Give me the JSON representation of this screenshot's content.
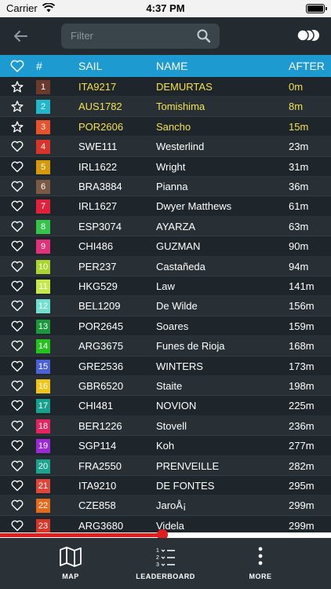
{
  "status_bar": {
    "carrier": "Carrier",
    "time": "4:37 PM"
  },
  "search": {
    "placeholder": "Filter"
  },
  "table": {
    "headers": {
      "pos": "#",
      "sail": "SAIL",
      "name": "NAME",
      "after": "AFTER"
    },
    "rows": [
      {
        "pos": "1",
        "color": "#6a3b2c",
        "sail": "ITA9217",
        "name": "DEMURTAS",
        "after": "0m",
        "favorite": "star"
      },
      {
        "pos": "2",
        "color": "#22b7c8",
        "sail": "AUS1782",
        "name": "Tomishima",
        "after": "8m",
        "favorite": "star"
      },
      {
        "pos": "3",
        "color": "#e8512a",
        "sail": "POR2606",
        "name": "Sancho",
        "after": "15m",
        "favorite": "star"
      },
      {
        "pos": "4",
        "color": "#d8352a",
        "sail": "SWE111",
        "name": "Westerlind",
        "after": "23m",
        "favorite": "heart"
      },
      {
        "pos": "5",
        "color": "#d49a0c",
        "sail": "IRL1622",
        "name": "Wright",
        "after": "31m",
        "favorite": "heart"
      },
      {
        "pos": "6",
        "color": "#7b5a45",
        "sail": "BRA3884",
        "name": "Pianna",
        "after": "36m",
        "favorite": "heart"
      },
      {
        "pos": "7",
        "color": "#e0213d",
        "sail": "IRL1627",
        "name": "Dwyer Matthews",
        "after": "61m",
        "favorite": "heart"
      },
      {
        "pos": "8",
        "color": "#35c34b",
        "sail": "ESP3074",
        "name": "AYARZA",
        "after": "63m",
        "favorite": "heart"
      },
      {
        "pos": "9",
        "color": "#e2317a",
        "sail": "CHI486",
        "name": "GUZMAN",
        "after": "90m",
        "favorite": "heart"
      },
      {
        "pos": "10",
        "color": "#a8d62c",
        "sail": "PER237",
        "name": "Castañeda",
        "after": "94m",
        "favorite": "heart"
      },
      {
        "pos": "11",
        "color": "#c6e84a",
        "sail": "HKG529",
        "name": "Law",
        "after": "141m",
        "favorite": "heart"
      },
      {
        "pos": "12",
        "color": "#6fe0cf",
        "sail": "BEL1209",
        "name": "De Wilde",
        "after": "156m",
        "favorite": "heart"
      },
      {
        "pos": "13",
        "color": "#1a9a3c",
        "sail": "POR2645",
        "name": "Soares",
        "after": "159m",
        "favorite": "heart"
      },
      {
        "pos": "14",
        "color": "#25c11f",
        "sail": "ARG3675",
        "name": "Funes de Rioja",
        "after": "168m",
        "favorite": "heart"
      },
      {
        "pos": "15",
        "color": "#4b62d6",
        "sail": "GRE2536",
        "name": "WINTERS",
        "after": "173m",
        "favorite": "heart"
      },
      {
        "pos": "16",
        "color": "#f0c419",
        "sail": "GBR6520",
        "name": "Staite",
        "after": "198m",
        "favorite": "heart"
      },
      {
        "pos": "17",
        "color": "#18a08e",
        "sail": "CHI481",
        "name": "NOVION",
        "after": "225m",
        "favorite": "heart"
      },
      {
        "pos": "18",
        "color": "#e3245e",
        "sail": "BER1226",
        "name": "Stovell",
        "after": "236m",
        "favorite": "heart"
      },
      {
        "pos": "19",
        "color": "#9b2ad6",
        "sail": "SGP114",
        "name": "Koh",
        "after": "277m",
        "favorite": "heart"
      },
      {
        "pos": "20",
        "color": "#1aa58e",
        "sail": "FRA2550",
        "name": "PRENVEILLE",
        "after": "282m",
        "favorite": "heart"
      },
      {
        "pos": "21",
        "color": "#e0473b",
        "sail": "ITA9210",
        "name": "DE FONTES",
        "after": "295m",
        "favorite": "heart"
      },
      {
        "pos": "22",
        "color": "#e56a1a",
        "sail": "CZE858",
        "name": "JaroÅ¡",
        "after": "299m",
        "favorite": "heart"
      },
      {
        "pos": "23",
        "color": "#d8352a",
        "sail": "ARG3680",
        "name": "Videla",
        "after": "299m",
        "favorite": "heart"
      }
    ]
  },
  "playback": {
    "progress": 0.49
  },
  "tabbar": {
    "map_label": "MAP",
    "leaderboard_label": "LEADERBOARD",
    "more_label": "MORE"
  },
  "icons": {
    "back": "arrow-left-icon",
    "search": "magnifier-icon",
    "toggle": "circles-toggle-icon",
    "favorite_header": "heart-outline-icon",
    "map": "folded-map-icon",
    "leaderboard": "ranked-list-icon",
    "more": "vertical-dots-icon"
  },
  "colors": {
    "header": "#1d9bd1",
    "highlight_text": "#f4e24a",
    "progress": "#e11d1d"
  }
}
